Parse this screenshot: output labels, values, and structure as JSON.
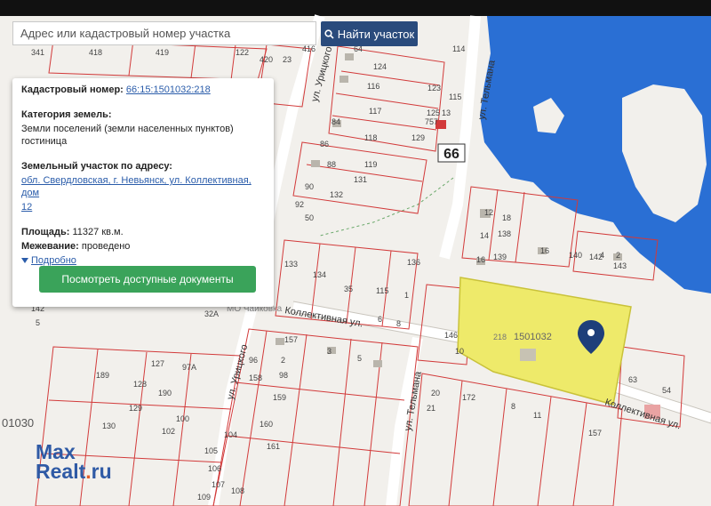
{
  "search": {
    "placeholder": "Адрес или кадастровый номер участка",
    "button_label": "Найти участок"
  },
  "info": {
    "cadastral_label": "Кадастровый номер:",
    "cadastral_value": "66:15:1501032:218",
    "category_label": "Категория земель:",
    "category_value": "Земли поселений (земли населенных пунктов) гостиница",
    "address_label": "Земельный участок по адресу:",
    "address_line1": "обл. Свердловская, г. Невьянск, ул. Коллективная, дом",
    "address_line2": "12",
    "area_label": "Площадь:",
    "area_value": "11327 кв.м.",
    "survey_label": "Межевание:",
    "survey_value": "проведено",
    "details_toggle": "Подробно",
    "docs_button": "Посмотреть доступные документы"
  },
  "map": {
    "street_kollektivnaya": "Коллективная ул.",
    "street_kollektivnaya_2": "Коллективная ул.",
    "street_telmana_top": "ул. Тельмана",
    "street_telmana_bottom": "ул. Тельмана",
    "street_urickogo_top": "ул. Урицкого",
    "street_urickogo_bottom": "ул. Урицкого",
    "road_number": "66",
    "parcel_label": "1501032",
    "parcel_num": "218",
    "quarter_label": "01030",
    "place_label": "МО Чайковка",
    "selected_color": "#eeea6a",
    "water_color": "#2a6fd4",
    "plots": [
      "341",
      "418",
      "419",
      "122",
      "420",
      "23",
      "416",
      "64",
      "124",
      "114",
      "115",
      "116",
      "123",
      "117",
      "125",
      "13",
      "757",
      "129",
      "84",
      "118",
      "86",
      "119",
      "88",
      "131",
      "90",
      "132",
      "92",
      "50",
      "12",
      "18",
      "14",
      "138",
      "16",
      "139",
      "133",
      "134",
      "35",
      "136",
      "115",
      "1",
      "6",
      "8",
      "143",
      "140",
      "142",
      "4",
      "2",
      "16",
      "142",
      "5",
      "32A",
      "157",
      "3",
      "5",
      "96",
      "2",
      "158",
      "98",
      "159",
      "127",
      "97A",
      "189",
      "128",
      "190",
      "129",
      "100",
      "130",
      "102",
      "160",
      "104",
      "161",
      "105",
      "106",
      "107",
      "108",
      "109",
      "20",
      "172",
      "8",
      "11",
      "157",
      "63",
      "54",
      "10",
      "146",
      "21"
    ]
  },
  "watermark": {
    "line1": "Max",
    "line2_main": "Realt",
    "line2_dot": ".",
    "line2_tld": "ru"
  }
}
